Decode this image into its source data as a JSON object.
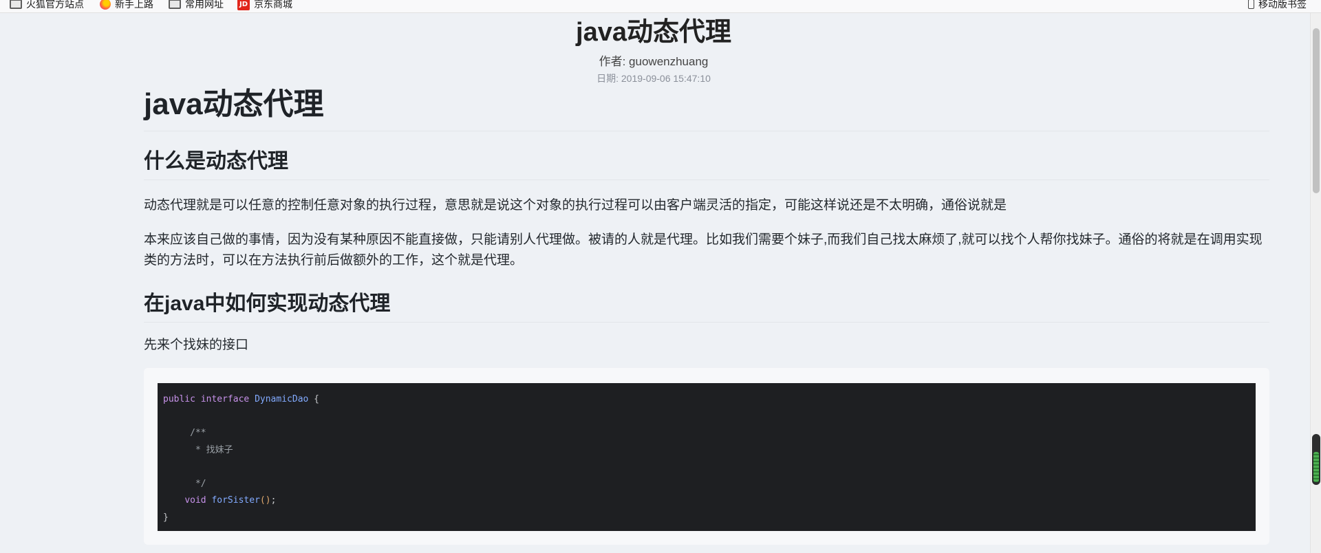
{
  "bookmarks": [
    {
      "label": "火狐官方站点",
      "icon": "folder-icon"
    },
    {
      "label": "新手上路",
      "icon": "firefox-icon"
    },
    {
      "label": "常用网址",
      "icon": "folder-icon"
    },
    {
      "label": "京东商城",
      "icon": "jd-icon"
    }
  ],
  "mobile_bookmarks": "移动版书签",
  "jd_glyph": "JD",
  "header": {
    "title": "java动态代理",
    "author": "作者: guowenzhuang",
    "date": "日期: 2019-09-06 15:47:10"
  },
  "article": {
    "h1": "java动态代理",
    "section1_title": "什么是动态代理",
    "para1": "动态代理就是可以任意的控制任意对象的执行过程，意思就是说这个对象的执行过程可以由客户端灵活的指定，可能这样说还是不太明确，通俗说就是",
    "para2": "本来应该自己做的事情，因为没有某种原因不能直接做，只能请别人代理做。被请的人就是代理。比如我们需要个妹子,而我们自己找太麻烦了,就可以找个人帮你找妹子。通俗的将就是在调用实现类的方法时，可以在方法执行前后做额外的工作，这个就是代理。",
    "section2_title": "在java中如何实现动态代理",
    "para3": "先来个找妹的接口"
  },
  "code": {
    "kw_public": "public",
    "kw_interface": "interface",
    "class_name": "DynamicDao",
    "brace_open": " {",
    "comment_open": "/**",
    "comment_body": " * 找妹子",
    "comment_close": " */",
    "kw_void": "void",
    "method": "forSister",
    "parens": "()",
    "semicolon": ";",
    "brace_close": "}"
  }
}
